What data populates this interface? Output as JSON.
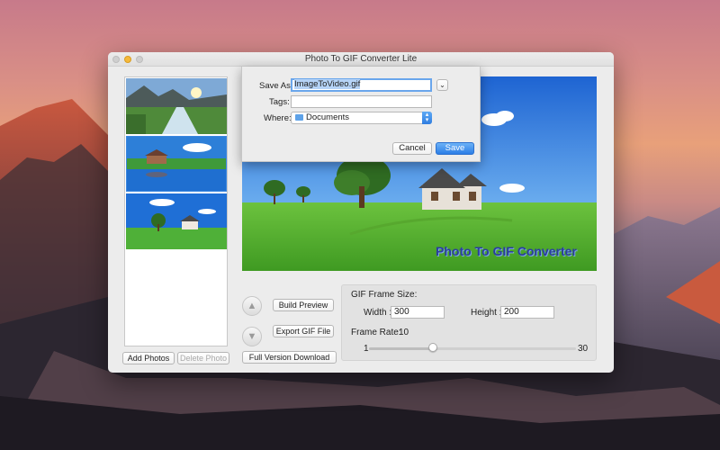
{
  "window": {
    "title": "Photo To GIF Converter Lite"
  },
  "photo_list": {
    "thumbnails": [
      "mountain-stream-photo",
      "lake-house-photo",
      "house-tree-photo"
    ],
    "add_label": "Add  Photos",
    "delete_label": "Delete Photo"
  },
  "preview": {
    "overlay_text": "Photo To GIF Converter"
  },
  "controls": {
    "build_preview": "Build Preview",
    "export_gif": "Export GIF File",
    "full_version": "Full Version Download",
    "up_arrow": "▲",
    "down_arrow": "▼"
  },
  "settings": {
    "frame_size_label": "GIF Frame Size:",
    "width_label": "Width :",
    "width_value": "300",
    "height_label": "Height :",
    "height_value": "200",
    "frame_rate_label": "Frame Rate:",
    "frame_rate_value": "10",
    "slider_min": "1",
    "slider_max": "30",
    "slider_fraction": 0.31
  },
  "save_sheet": {
    "save_as_label": "Save As:",
    "save_as_value": "ImageToVideo.gif",
    "tags_label": "Tags:",
    "tags_value": "",
    "where_label": "Where:",
    "where_value": "Documents",
    "cancel_label": "Cancel",
    "save_label": "Save"
  },
  "colors": {
    "accent": "#2c7ee6",
    "selection": "#b5d3f7"
  }
}
